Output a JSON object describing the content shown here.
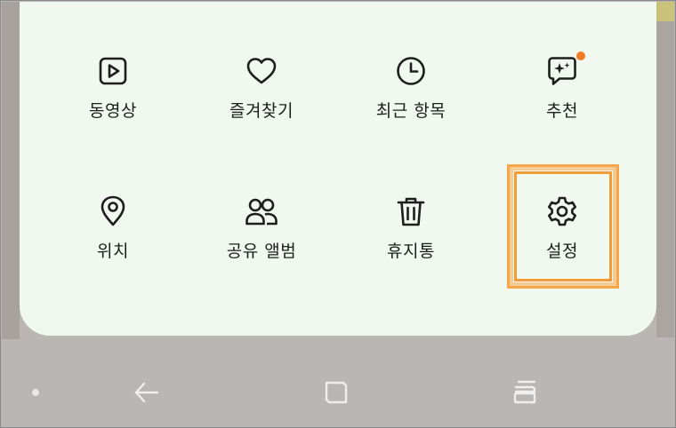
{
  "menu": {
    "items": [
      {
        "label": "동영상",
        "icon": "video-play-icon"
      },
      {
        "label": "즐겨찾기",
        "icon": "heart-icon"
      },
      {
        "label": "최근 항목",
        "icon": "clock-icon"
      },
      {
        "label": "추천",
        "icon": "sparkle-chat-icon",
        "badge": true
      },
      {
        "label": "위치",
        "icon": "location-pin-icon"
      },
      {
        "label": "공유 앨범",
        "icon": "people-icon"
      },
      {
        "label": "휴지통",
        "icon": "trash-icon"
      },
      {
        "label": "설정",
        "icon": "gear-icon",
        "highlighted": true
      }
    ]
  },
  "colors": {
    "card_background": "#f0f8ef",
    "badge": "#f07a26",
    "highlight": "#f7a64a",
    "label_text": "#1e1e1e",
    "nav_icon": "#efefef"
  },
  "nav_bar": {
    "buttons": [
      "back-icon",
      "home-icon",
      "recents-icon"
    ]
  }
}
